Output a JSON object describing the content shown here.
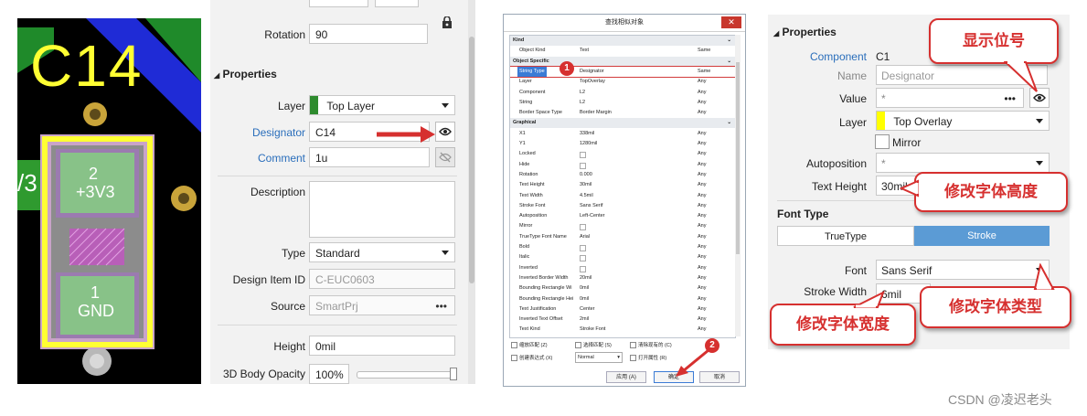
{
  "pcb": {
    "designator": "C14",
    "pad_top_num": "2",
    "pad_top_net": "+3V3",
    "pad_bottom_num": "1",
    "pad_bottom_net": "GND",
    "left_net_fragment": "/3"
  },
  "panel1": {
    "rotation_label": "Rotation",
    "rotation_value": "90",
    "section_title": "Properties",
    "layer_label": "Layer",
    "layer_value": "Top Layer",
    "designator_label": "Designator",
    "designator_value": "C14",
    "comment_label": "Comment",
    "comment_value": "1u",
    "description_label": "Description",
    "description_value": "",
    "type_label": "Type",
    "type_value": "Standard",
    "design_item_label": "Design Item ID",
    "design_item_value": "C-EUC0603",
    "source_label": "Source",
    "source_value": "SmartPrj",
    "height_label": "Height",
    "height_value": "0mil",
    "opacity_label": "3D Body Opacity",
    "opacity_value": "100%",
    "ellipsis": "•••"
  },
  "dialog": {
    "title": "查找相似对象",
    "close_glyph": "✕",
    "rows": [
      {
        "kind": "cat",
        "c1": "Kind",
        "c2": "",
        "c3": ""
      },
      {
        "kind": "row",
        "c1": "Object Kind",
        "c2": "Text",
        "c3": "Same"
      },
      {
        "kind": "cat",
        "c1": "Object Specific",
        "c2": "",
        "c3": ""
      },
      {
        "kind": "hl",
        "c1": "String Type",
        "c2": "Designator",
        "c3": "Same"
      },
      {
        "kind": "row",
        "c1": "Layer",
        "c2": "TopOverlay",
        "c3": "Any"
      },
      {
        "kind": "row",
        "c1": "Component",
        "c2": "L2",
        "c3": "Any"
      },
      {
        "kind": "row",
        "c1": "String",
        "c2": "L2",
        "c3": "Any"
      },
      {
        "kind": "row",
        "c1": "Border Space Type",
        "c2": "Border Margin",
        "c3": "Any"
      },
      {
        "kind": "cat",
        "c1": "Graphical",
        "c2": "",
        "c3": ""
      },
      {
        "kind": "row",
        "c1": "X1",
        "c2": "338mil",
        "c3": "Any"
      },
      {
        "kind": "row",
        "c1": "Y1",
        "c2": "1280mil",
        "c3": "Any"
      },
      {
        "kind": "chk",
        "c1": "Locked",
        "c2": "",
        "c3": "Any"
      },
      {
        "kind": "chk",
        "c1": "Hide",
        "c2": "",
        "c3": "Any"
      },
      {
        "kind": "row",
        "c1": "Rotation",
        "c2": "0.000",
        "c3": "Any"
      },
      {
        "kind": "row",
        "c1": "Text Height",
        "c2": "30mil",
        "c3": "Any"
      },
      {
        "kind": "row",
        "c1": "Text Width",
        "c2": "4.5mil",
        "c3": "Any"
      },
      {
        "kind": "row",
        "c1": "Stroke Font",
        "c2": "Sans Serif",
        "c3": "Any"
      },
      {
        "kind": "row",
        "c1": "Autoposition",
        "c2": "Left-Center",
        "c3": "Any"
      },
      {
        "kind": "chk",
        "c1": "Mirror",
        "c2": "",
        "c3": "Any"
      },
      {
        "kind": "row",
        "c1": "TrueType Font Name",
        "c2": "Arial",
        "c3": "Any"
      },
      {
        "kind": "chk",
        "c1": "Bold",
        "c2": "",
        "c3": "Any"
      },
      {
        "kind": "chk",
        "c1": "Italic",
        "c2": "",
        "c3": "Any"
      },
      {
        "kind": "chk",
        "c1": "Inverted",
        "c2": "",
        "c3": "Any"
      },
      {
        "kind": "row",
        "c1": "Inverted Border Width",
        "c2": "20mil",
        "c3": "Any"
      },
      {
        "kind": "row",
        "c1": "Bounding Rectangle Wi",
        "c2": "0mil",
        "c3": "Any"
      },
      {
        "kind": "row",
        "c1": "Bounding Rectangle Hei",
        "c2": "0mil",
        "c3": "Any"
      },
      {
        "kind": "row",
        "c1": "Text Justification",
        "c2": "Center",
        "c3": "Any"
      },
      {
        "kind": "row",
        "c1": "Inverted Text Offset",
        "c2": "2mil",
        "c3": "Any"
      },
      {
        "kind": "row",
        "c1": "Text Kind",
        "c2": "Stroke Font",
        "c3": "Any"
      }
    ],
    "opt_zoom": "缩放匹配 (Z)",
    "opt_select": "选择匹配 (S)",
    "opt_clear": "清除现有的 (C)",
    "opt_create_expr": "创建表达式 (X)",
    "opt_mode": "Normal",
    "opt_open_panel": "打开属性 (R)",
    "btn_apply": "应用 (A)",
    "btn_ok": "确定",
    "btn_cancel": "取消",
    "badge1": "1",
    "badge2": "2"
  },
  "panel2": {
    "section_title": "Properties",
    "component_label": "Component",
    "component_value": "C1",
    "name_label": "Name",
    "name_value": "Designator",
    "value_label": "Value",
    "value_value": "*",
    "layer_label": "Layer",
    "layer_value": "Top Overlay",
    "mirror_label": "Mirror",
    "autopos_label": "Autoposition",
    "autopos_value": "*",
    "text_height_label": "Text Height",
    "text_height_value": "30mil",
    "font_type_title": "Font Type",
    "tab_truetype": "TrueType",
    "tab_stroke": "Stroke",
    "font_label": "Font",
    "font_value": "Sans Serif",
    "stroke_width_label": "Stroke Width",
    "stroke_width_value": "6mil",
    "ellipsis": "•••"
  },
  "callouts": {
    "show_designator": "显示位号",
    "text_height": "修改字体高度",
    "font_type": "修改字体类型",
    "font_width": "修改字体宽度"
  },
  "watermark": "CSDN @凌迟老头",
  "colors": {
    "accent_red": "#d6302f",
    "stroke_blue": "#5b9bd5",
    "silk_yellow": "#ffff33",
    "top_layer_green": "#2e8b2e",
    "top_overlay_yellow": "#ffff00"
  }
}
